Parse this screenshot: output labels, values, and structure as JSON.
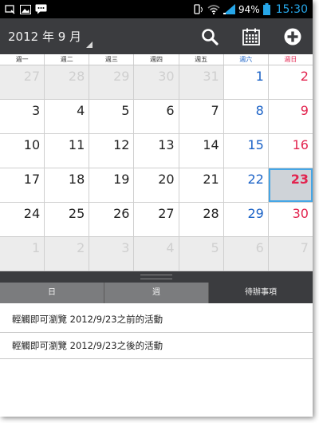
{
  "statusbar": {
    "battery_percent": "94%",
    "time": "15:30"
  },
  "actionbar": {
    "month_label": "2012 年 9 月",
    "actions": [
      {
        "icon": "search-icon"
      },
      {
        "icon": "calendar-icon"
      },
      {
        "icon": "add-icon"
      }
    ]
  },
  "colors": {
    "saturday": "#1c63c7",
    "sunday": "#e2244f",
    "selected_border": "#45a6e6",
    "clock": "#26a6e8",
    "actionbar": "#3b3c3f"
  },
  "weekdays": [
    "週一",
    "週二",
    "週三",
    "週四",
    "週五",
    "週六",
    "週日"
  ],
  "calendar": {
    "weeks": [
      [
        {
          "d": "27",
          "o": true
        },
        {
          "d": "28",
          "o": true
        },
        {
          "d": "29",
          "o": true
        },
        {
          "d": "30",
          "o": true
        },
        {
          "d": "31",
          "o": true
        },
        {
          "d": "1",
          "o": false
        },
        {
          "d": "2",
          "o": false
        }
      ],
      [
        {
          "d": "3",
          "o": false
        },
        {
          "d": "4",
          "o": false
        },
        {
          "d": "5",
          "o": false
        },
        {
          "d": "6",
          "o": false
        },
        {
          "d": "7",
          "o": false
        },
        {
          "d": "8",
          "o": false
        },
        {
          "d": "9",
          "o": false
        }
      ],
      [
        {
          "d": "10",
          "o": false
        },
        {
          "d": "11",
          "o": false
        },
        {
          "d": "12",
          "o": false
        },
        {
          "d": "13",
          "o": false
        },
        {
          "d": "14",
          "o": false
        },
        {
          "d": "15",
          "o": false
        },
        {
          "d": "16",
          "o": false
        }
      ],
      [
        {
          "d": "17",
          "o": false
        },
        {
          "d": "18",
          "o": false
        },
        {
          "d": "19",
          "o": false
        },
        {
          "d": "20",
          "o": false
        },
        {
          "d": "21",
          "o": false
        },
        {
          "d": "22",
          "o": false
        },
        {
          "d": "23",
          "o": false,
          "selected": true
        }
      ],
      [
        {
          "d": "24",
          "o": false
        },
        {
          "d": "25",
          "o": false
        },
        {
          "d": "26",
          "o": false
        },
        {
          "d": "27",
          "o": false
        },
        {
          "d": "28",
          "o": false
        },
        {
          "d": "29",
          "o": false
        },
        {
          "d": "30",
          "o": false
        }
      ],
      [
        {
          "d": "1",
          "o": true
        },
        {
          "d": "2",
          "o": true
        },
        {
          "d": "3",
          "o": true
        },
        {
          "d": "4",
          "o": true
        },
        {
          "d": "5",
          "o": true
        },
        {
          "d": "6",
          "o": true
        },
        {
          "d": "7",
          "o": true
        }
      ]
    ]
  },
  "tabs": [
    {
      "label": "日",
      "active": false
    },
    {
      "label": "週",
      "active": false
    },
    {
      "label": "待辦事項",
      "active": true
    }
  ],
  "list": [
    "輕觸即可瀏覽 2012/9/23之前的活動",
    "輕觸即可瀏覽 2012/9/23之後的活動"
  ]
}
